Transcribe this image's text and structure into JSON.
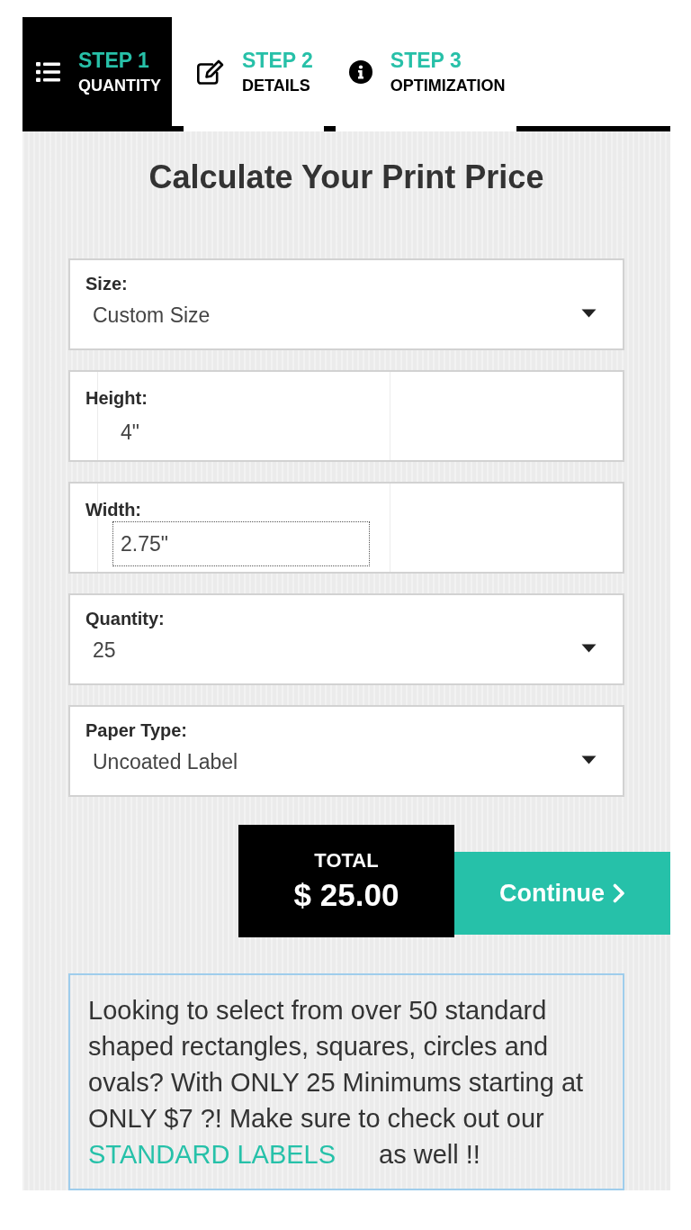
{
  "steps": [
    {
      "kind": "list",
      "step": "STEP 1",
      "label": "QUANTITY",
      "selected": true
    },
    {
      "kind": "edit",
      "step": "STEP 2",
      "label": "DETAILS",
      "selected": false
    },
    {
      "kind": "info",
      "step": "STEP 3",
      "label": "OPTIMIZATION",
      "selected": false
    }
  ],
  "title": "Calculate Your Print Price",
  "fields": [
    {
      "kind": "select",
      "label": "Size:",
      "value": "Custom Size",
      "focused": false
    },
    {
      "kind": "text",
      "label": "Height:",
      "value": "4\"",
      "focused": false
    },
    {
      "kind": "text",
      "label": "Width:",
      "value": "2.75\"",
      "focused": true
    },
    {
      "kind": "select",
      "label": "Quantity:",
      "value": "25",
      "focused": false
    },
    {
      "kind": "select",
      "label": "Paper Type:",
      "value": "Uncoated Label",
      "focused": false
    }
  ],
  "total": {
    "label": "TOTAL",
    "amount": "$ 25.00"
  },
  "continue_button": {
    "label": "Continue"
  },
  "notice": {
    "text": "Looking to select from over 50 standard shaped rectangles, squares, circles and ovals? With ONLY 25 Minimums starting at ONLY $7 ?! Make sure to check out our",
    "link": "STANDARD LABELS",
    "after_link": "as well !!"
  }
}
